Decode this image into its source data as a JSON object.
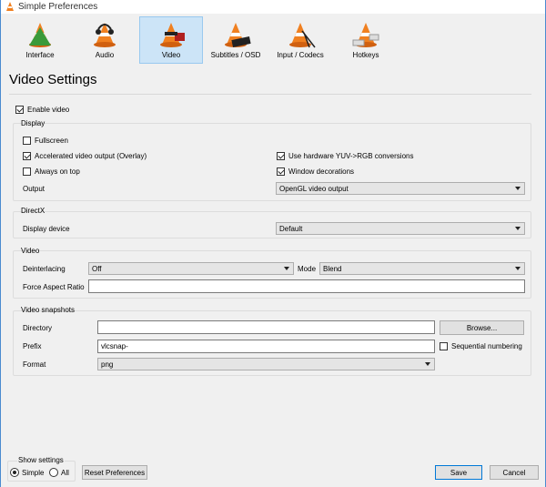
{
  "window": {
    "title": "Simple Preferences"
  },
  "toolbar": {
    "items": [
      {
        "label": "Interface"
      },
      {
        "label": "Audio"
      },
      {
        "label": "Video",
        "selected": true
      },
      {
        "label": "Subtitles / OSD"
      },
      {
        "label": "Input / Codecs"
      },
      {
        "label": "Hotkeys"
      }
    ]
  },
  "page_title": "Video Settings",
  "enable_video": {
    "label": "Enable video",
    "checked": true
  },
  "display": {
    "title": "Display",
    "fullscreen": "Fullscreen",
    "accelerated": "Accelerated video output (Overlay)",
    "always_on_top": "Always on top",
    "hw_yuv": "Use hardware YUV->RGB conversions",
    "window_decorations": "Window decorations",
    "output_label": "Output",
    "output_value": "OpenGL video output"
  },
  "directx": {
    "title": "DirectX",
    "device_label": "Display device",
    "device_value": "Default"
  },
  "video": {
    "title": "Video",
    "deinterlacing_label": "Deinterlacing",
    "deinterlacing_value": "Off",
    "mode_label": "Mode",
    "mode_value": "Blend",
    "aspect_label": "Force Aspect Ratio",
    "aspect_value": ""
  },
  "snapshots": {
    "title": "Video snapshots",
    "directory_label": "Directory",
    "directory_value": "",
    "browse": "Browse...",
    "prefix_label": "Prefix",
    "prefix_value": "vlcsnap-",
    "sequential": "Sequential numbering",
    "format_label": "Format",
    "format_value": "png"
  },
  "footer": {
    "show_settings": "Show settings",
    "simple": "Simple",
    "all": "All",
    "reset": "Reset Preferences",
    "save": "Save",
    "cancel": "Cancel"
  },
  "colors": {
    "cone": "#f08020",
    "selected": "#cce4f7",
    "accent": "#0078d7"
  }
}
